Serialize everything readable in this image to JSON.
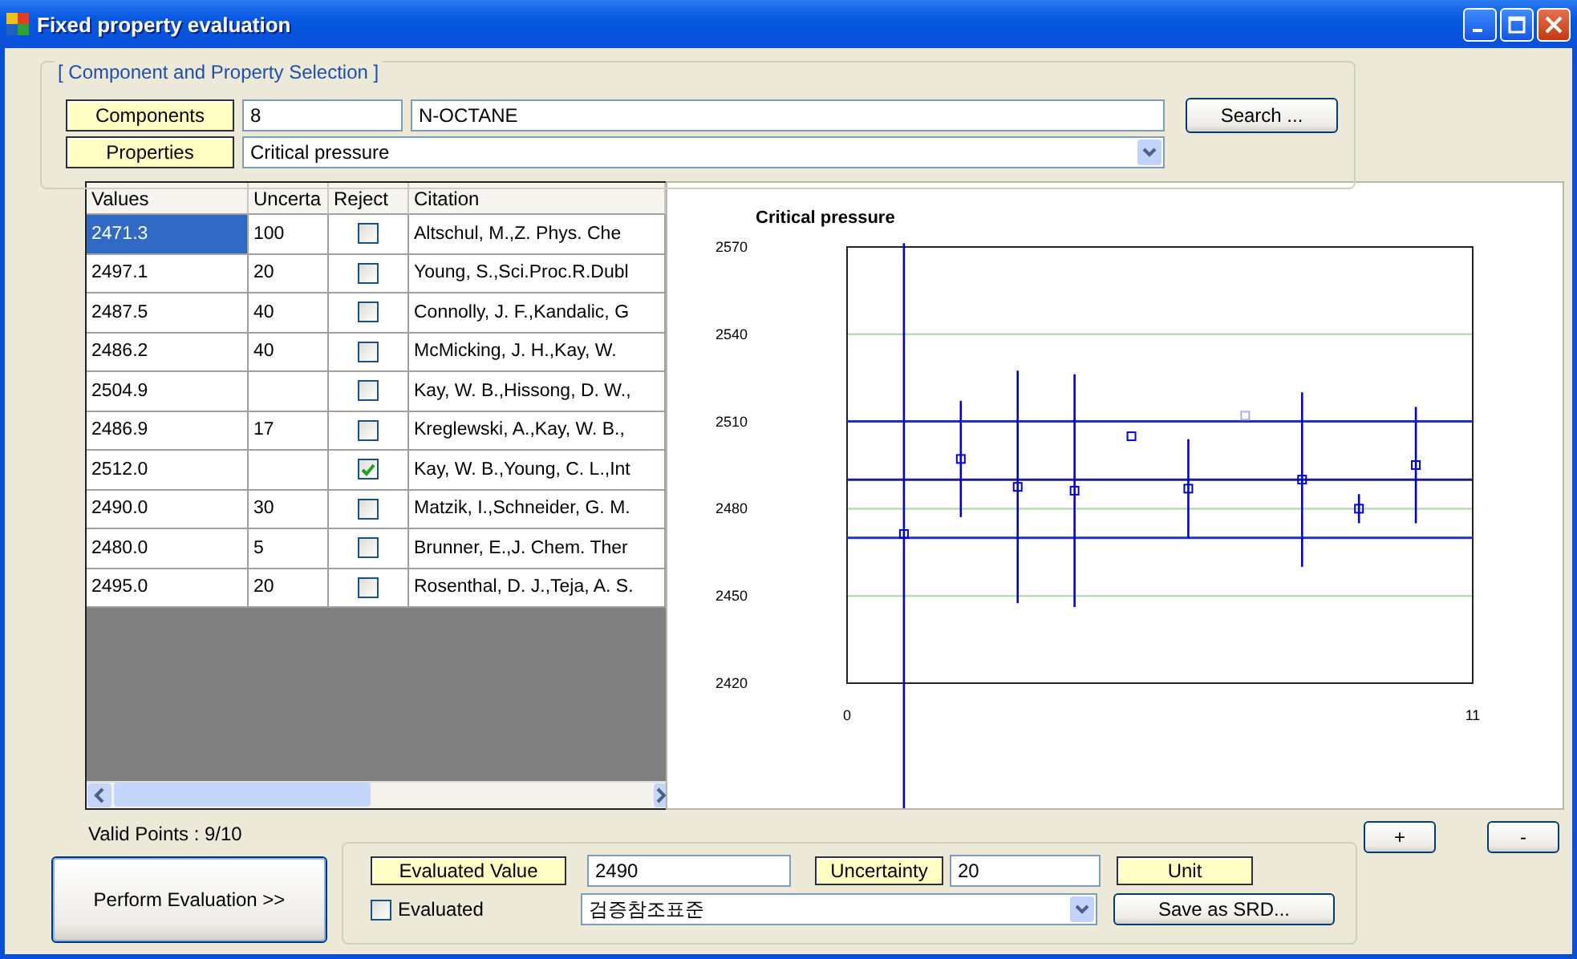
{
  "window": {
    "title": "Fixed property evaluation"
  },
  "selection": {
    "title": "[ Component and Property Selection ]",
    "components_label": "Components",
    "component_id": "8",
    "component_name": "N-OCTANE",
    "search_button": "Search ...",
    "properties_label": "Properties",
    "property": "Critical pressure"
  },
  "grid": {
    "columns": [
      "Values",
      "Uncerta",
      "Reject",
      "Citation"
    ],
    "rows": [
      {
        "value": "2471.3",
        "uncertainty": "100",
        "reject": false,
        "citation": "Altschul, M.,Z. Phys. Che",
        "selected": true
      },
      {
        "value": "2497.1",
        "uncertainty": "20",
        "reject": false,
        "citation": "Young, S.,Sci.Proc.R.Dubl",
        "selected": false
      },
      {
        "value": "2487.5",
        "uncertainty": "40",
        "reject": false,
        "citation": "Connolly, J. F.,Kandalic, G",
        "selected": false
      },
      {
        "value": "2486.2",
        "uncertainty": "40",
        "reject": false,
        "citation": "McMicking, J. H.,Kay, W.",
        "selected": false
      },
      {
        "value": "2504.9",
        "uncertainty": "",
        "reject": false,
        "citation": "Kay, W. B.,Hissong, D. W.,",
        "selected": false
      },
      {
        "value": "2486.9",
        "uncertainty": "17",
        "reject": false,
        "citation": "Kreglewski, A.,Kay, W. B.,",
        "selected": false
      },
      {
        "value": "2512.0",
        "uncertainty": "",
        "reject": true,
        "citation": "Kay, W. B.,Young, C. L.,Int",
        "selected": false
      },
      {
        "value": "2490.0",
        "uncertainty": "30",
        "reject": false,
        "citation": "Matzik, I.,Schneider, G. M.",
        "selected": false
      },
      {
        "value": "2480.0",
        "uncertainty": "5",
        "reject": false,
        "citation": "Brunner, E.,J. Chem. Ther",
        "selected": false
      },
      {
        "value": "2495.0",
        "uncertainty": "20",
        "reject": false,
        "citation": "Rosenthal, D. J.,Teja, A. S.",
        "selected": false
      }
    ]
  },
  "chart": {
    "chart_data": {
      "type": "scatter",
      "title": "Critical pressure",
      "x": [
        1,
        2,
        3,
        4,
        5,
        6,
        7,
        8,
        9,
        10
      ],
      "series": [
        {
          "color": "#0000cc",
          "values": [
            2471.3,
            2497.1,
            2487.5,
            2486.2,
            2504.9,
            2486.9,
            null,
            2490.0,
            2480.0,
            2495.0
          ],
          "errors": [
            100,
            20,
            40,
            40,
            null,
            17,
            null,
            30,
            5,
            20
          ]
        },
        {
          "color": "#b0b0e0",
          "values": [
            null,
            null,
            null,
            null,
            null,
            null,
            2512.0,
            null,
            null,
            null
          ]
        }
      ],
      "ref_lines": [
        {
          "axis": "y",
          "value": 2470,
          "color": "#2030c0"
        },
        {
          "axis": "y",
          "value": 2490,
          "color": "#202080"
        },
        {
          "axis": "y",
          "value": 2510,
          "color": "#2030c0"
        }
      ],
      "grid": true,
      "xlim": [
        0,
        11
      ],
      "ylim": [
        2420,
        2570
      ],
      "xticks": [
        0,
        11
      ],
      "yticks": [
        2420,
        2450,
        2480,
        2510,
        2540,
        2570
      ]
    }
  },
  "valid_points": "Valid Points : 9/10",
  "zoom_buttons": [
    "+",
    "-"
  ],
  "perform_button": "Perform Evaluation >>",
  "evaluation": {
    "value_label": "Evaluated Value",
    "value": "2490",
    "uncertainty_label": "Uncertainty",
    "uncertainty": "20",
    "unit_label": "Unit",
    "evaluated_label": "Evaluated",
    "evaluated": false,
    "reference": "검증참조표준",
    "save_button": "Save as SRD..."
  }
}
